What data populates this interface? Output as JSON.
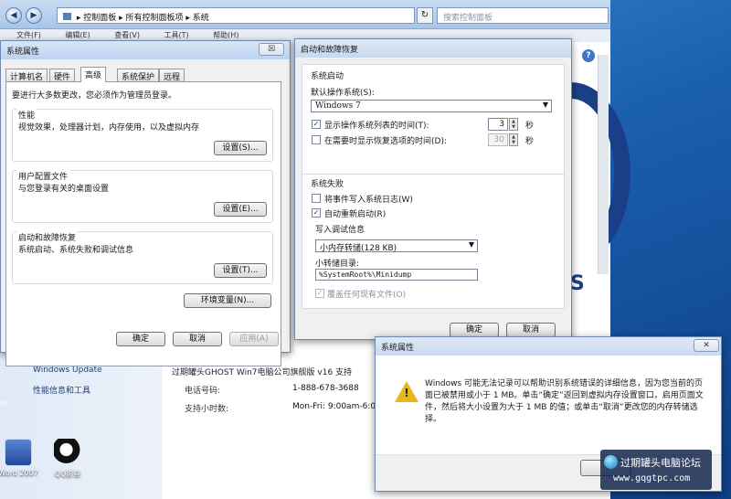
{
  "explorer": {
    "breadcrumb": "▸ 控制面板 ▸ 所有控制面板项 ▸ 系统",
    "search_placeholder": "搜索控制面板",
    "menu": [
      "文件(F)",
      "编辑(E)",
      "查看(V)",
      "工具(T)",
      "帮助(H)"
    ],
    "sidebar_links": [
      "Windows Update",
      "性能信息和工具"
    ],
    "support_title": "过期罐头GHOST Win7电脑公司旗舰版 v16 支持",
    "support_rows": [
      {
        "label": "电话号码:",
        "value": "1-888-678-3688"
      },
      {
        "label": "支持小时数:",
        "value": "Mon-Fri: 9:00am-6:0"
      }
    ]
  },
  "sys_props": {
    "title": "系统属性",
    "close": "☒",
    "tabs": [
      "计算机名",
      "硬件",
      "高级",
      "系统保护",
      "远程"
    ],
    "active_tab": 2,
    "intro": "要进行大多数更改，您必须作为管理员登录。",
    "groups": [
      {
        "title": "性能",
        "desc": "视觉效果，处理器计划，内存使用，以及虚拟内存",
        "button": "设置(S)..."
      },
      {
        "title": "用户配置文件",
        "desc": "与您登录有关的桌面设置",
        "button": "设置(E)..."
      },
      {
        "title": "启动和故障恢复",
        "desc": "系统启动、系统失败和调试信息",
        "button": "设置(T)..."
      }
    ],
    "env_button": "环境变量(N)...",
    "ok": "确定",
    "cancel": "取消",
    "apply": "应用(A)"
  },
  "startup": {
    "title": "启动和故障恢复",
    "boot_section": "系统启动",
    "default_os_label": "默认操作系统(S):",
    "default_os": "Windows 7",
    "show_list_label": "显示操作系统列表的时间(T):",
    "show_list_checked": true,
    "show_list_value": "3",
    "show_recovery_label": "在需要时显示恢复选项的时间(D):",
    "show_recovery_checked": false,
    "show_recovery_value": "30",
    "seconds": "秒",
    "failure_section": "系统失败",
    "write_log_label": "将事件写入系统日志(W)",
    "write_log_checked": false,
    "auto_restart_label": "自动重新启动(R)",
    "auto_restart_checked": true,
    "debug_info_label": "写入调试信息",
    "debug_type": "小内存转储(128 KB)",
    "dump_dir_label": "小转储目录:",
    "dump_dir": "%SystemRoot%\\Minidump",
    "overwrite_label": "覆盖任何现有文件(O)",
    "overwrite_checked": true,
    "ok": "确定",
    "cancel": "取消"
  },
  "alert": {
    "title": "系统属性",
    "close": "✕",
    "message": "Windows 可能无法记录可以帮助识别系统错误的详细信息，因为您当前的页面已被禁用或小于 1 MB。单击“确定”返回到虚拟内存设置窗口，启用页面文件，然后将大小设置为大于 1 MB 的值；或单击“取消”更改您的内存转储选择。"
  },
  "desktop": {
    "icons": [
      "Word 2007",
      "QQ影音"
    ],
    "left_edge_label": "xc"
  },
  "watermark": {
    "line1": "过期罐头电脑论坛",
    "line2": "www.gqgtpc.com"
  }
}
